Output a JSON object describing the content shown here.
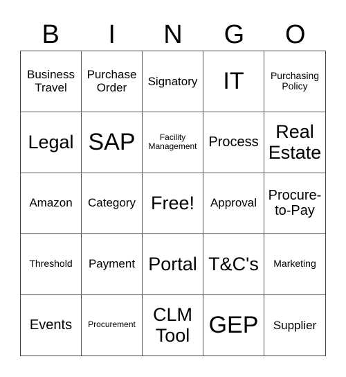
{
  "header": [
    "B",
    "I",
    "N",
    "G",
    "O"
  ],
  "cells": [
    {
      "text": "Business Travel",
      "size": "md"
    },
    {
      "text": "Purchase Order",
      "size": "md"
    },
    {
      "text": "Signatory",
      "size": "md"
    },
    {
      "text": "IT",
      "size": "xxl"
    },
    {
      "text": "Purchasing Policy",
      "size": "sm"
    },
    {
      "text": "Legal",
      "size": "xl"
    },
    {
      "text": "SAP",
      "size": "xxl"
    },
    {
      "text": "Facility Management",
      "size": "xs"
    },
    {
      "text": "Process",
      "size": "lg"
    },
    {
      "text": "Real Estate",
      "size": "xl"
    },
    {
      "text": "Amazon",
      "size": "md"
    },
    {
      "text": "Category",
      "size": "md"
    },
    {
      "text": "Free!",
      "size": "xl"
    },
    {
      "text": "Approval",
      "size": "md"
    },
    {
      "text": "Procure-to-Pay",
      "size": "lg"
    },
    {
      "text": "Threshold",
      "size": "sm"
    },
    {
      "text": "Payment",
      "size": "md"
    },
    {
      "text": "Portal",
      "size": "xl"
    },
    {
      "text": "T&C's",
      "size": "xl"
    },
    {
      "text": "Marketing",
      "size": "sm"
    },
    {
      "text": "Events",
      "size": "lg"
    },
    {
      "text": "Procurement",
      "size": "xs"
    },
    {
      "text": "CLM Tool",
      "size": "xl"
    },
    {
      "text": "GEP",
      "size": "xxl"
    },
    {
      "text": "Supplier",
      "size": "md"
    }
  ]
}
